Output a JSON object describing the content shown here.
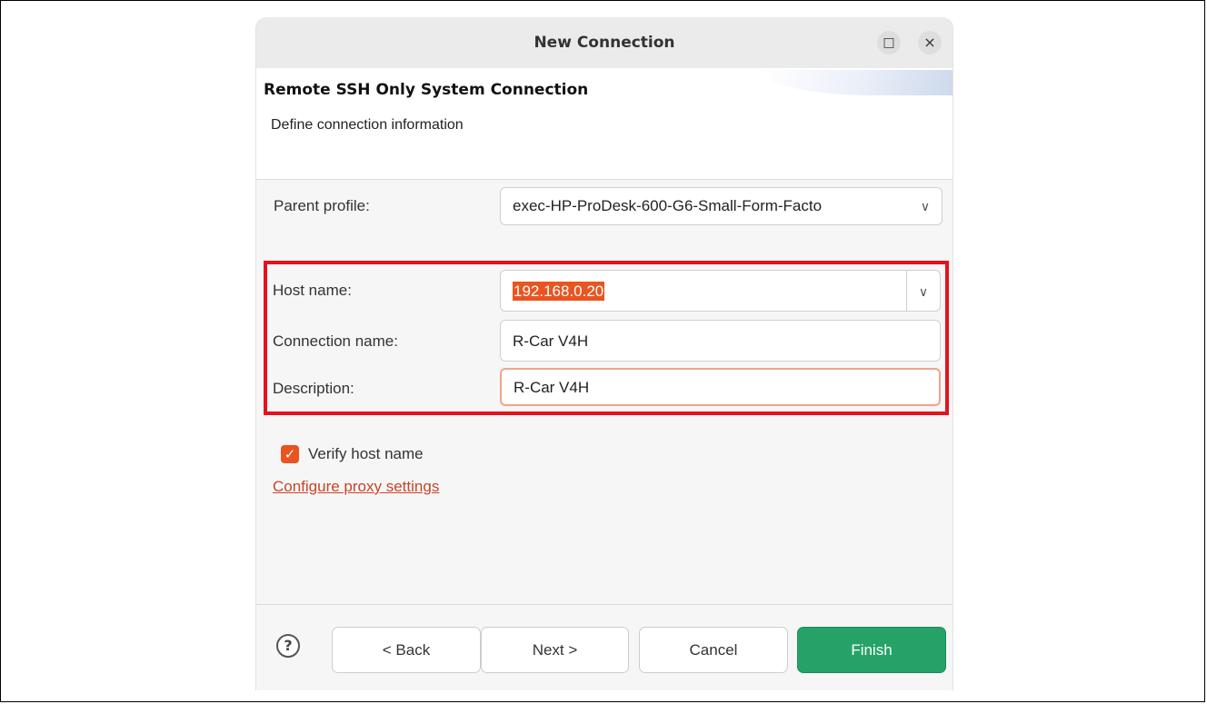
{
  "window": {
    "title": "New Connection",
    "maximize_icon": "□",
    "close_icon": "×"
  },
  "header": {
    "title": "Remote SSH Only System Connection",
    "subtitle": "Define connection information"
  },
  "form": {
    "parent_profile": {
      "label": "Parent profile:",
      "value": "exec-HP-ProDesk-600-G6-Small-Form-Facto"
    },
    "host_name": {
      "label": "Host name:",
      "value": "192.168.0.20"
    },
    "connection_name": {
      "label": "Connection name:",
      "value": "R-Car V4H"
    },
    "description": {
      "label": "Description:",
      "value": "R-Car V4H"
    },
    "verify_host": {
      "label": "Verify host name",
      "checked": true
    },
    "proxy_link": "Configure proxy settings"
  },
  "buttons": {
    "help": "?",
    "back": "< Back",
    "next": "Next >",
    "cancel": "Cancel",
    "finish": "Finish"
  },
  "colors": {
    "accent": "#e95420",
    "finish": "#26a269",
    "highlight": "#e8101c"
  }
}
